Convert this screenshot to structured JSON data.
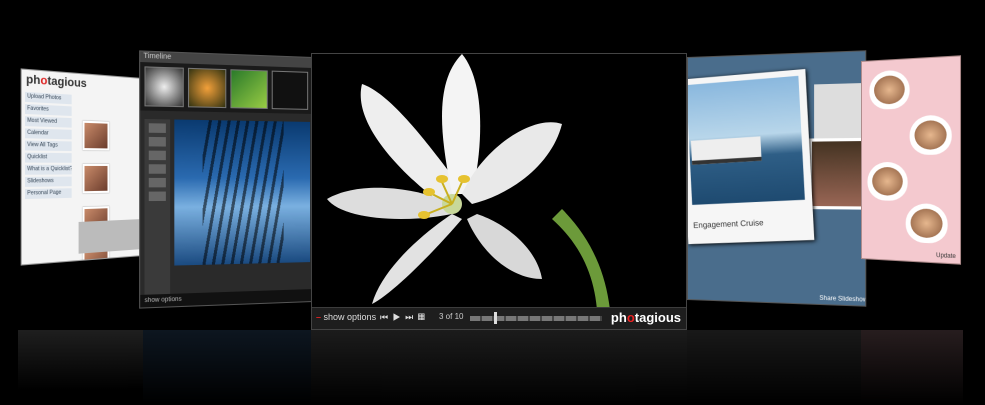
{
  "panel_left": {
    "logo_prefix": "ph",
    "logo_accent": "o",
    "logo_suffix": "tagious",
    "menu": [
      "Upload Photos",
      "Favorites",
      "Most Viewed",
      "Calendar",
      "View All Tags",
      "Quicklist",
      "What is a Quicklist?",
      "Slideshows",
      "Personal Page"
    ]
  },
  "panel_timeline": {
    "title": "Timeline",
    "footer": "show options"
  },
  "main_viewer": {
    "show_options": "show options",
    "counter": "3 of 10",
    "brand_prefix": "ph",
    "brand_accent": "o",
    "brand_suffix": "tagious",
    "accent_color": "#e22222"
  },
  "panel_cruise": {
    "caption": "Engagement Cruise",
    "footer": "Share Slideshow"
  },
  "panel_hearts": {
    "footer": "Update"
  },
  "icons": [
    "first-icon",
    "play-icon",
    "last-icon",
    "grid-icon"
  ]
}
